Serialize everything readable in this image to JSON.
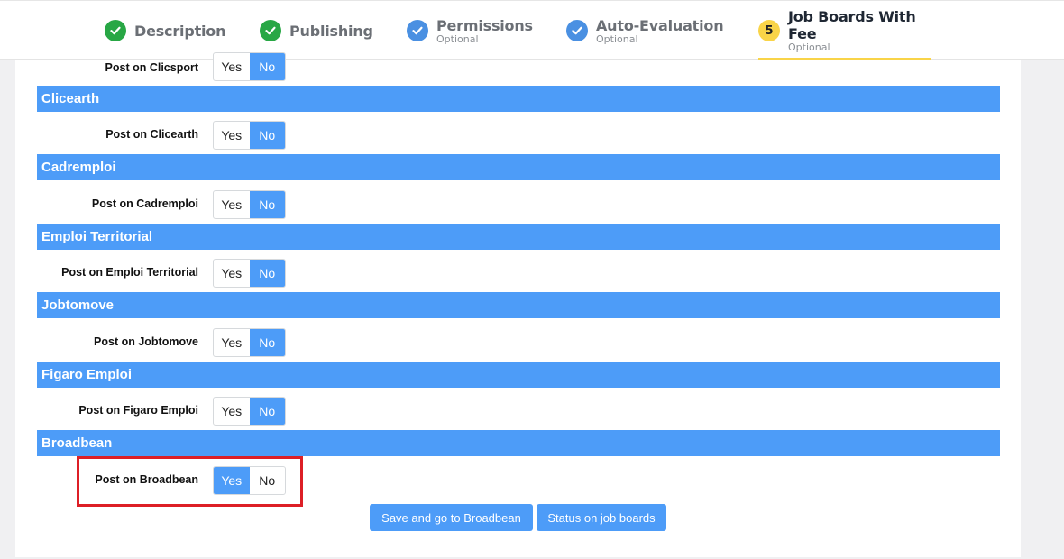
{
  "steps": [
    {
      "label": "Description",
      "sublabel": "",
      "icon": "check-icon",
      "state": "done-green"
    },
    {
      "label": "Publishing",
      "sublabel": "",
      "icon": "check-icon",
      "state": "done-green"
    },
    {
      "label": "Permissions",
      "sublabel": "Optional",
      "icon": "check-icon",
      "state": "done-blue"
    },
    {
      "label": "Auto-Evaluation",
      "sublabel": "Optional",
      "icon": "check-icon",
      "state": "done-blue"
    },
    {
      "label": "Job Boards With Fee",
      "sublabel": "Optional",
      "number": "5",
      "state": "active"
    }
  ],
  "colors": {
    "accent": "#4d9cf8",
    "done_green": "#28a745",
    "done_blue": "#4a90e2",
    "active_yellow": "#f9d448",
    "highlight_red": "#dd1f26"
  },
  "toggle": {
    "yes": "Yes",
    "no": "No"
  },
  "boards": [
    {
      "name": "",
      "post_label": "Post on Clicsport",
      "value": "No"
    },
    {
      "name": "Clicearth",
      "post_label": "Post on Clicearth",
      "value": "No"
    },
    {
      "name": "Cadremploi",
      "post_label": "Post on Cadremploi",
      "value": "No"
    },
    {
      "name": "Emploi Territorial",
      "post_label": "Post on Emploi Territorial",
      "value": "No"
    },
    {
      "name": "Jobtomove",
      "post_label": "Post on Jobtomove",
      "value": "No"
    },
    {
      "name": "Figaro Emploi",
      "post_label": "Post on Figaro Emploi",
      "value": "No"
    },
    {
      "name": "Broadbean",
      "post_label": "Post on Broadbean",
      "value": "Yes"
    }
  ],
  "actions": {
    "save_broadbean": "Save and go to Broadbean",
    "status": "Status on job boards"
  }
}
